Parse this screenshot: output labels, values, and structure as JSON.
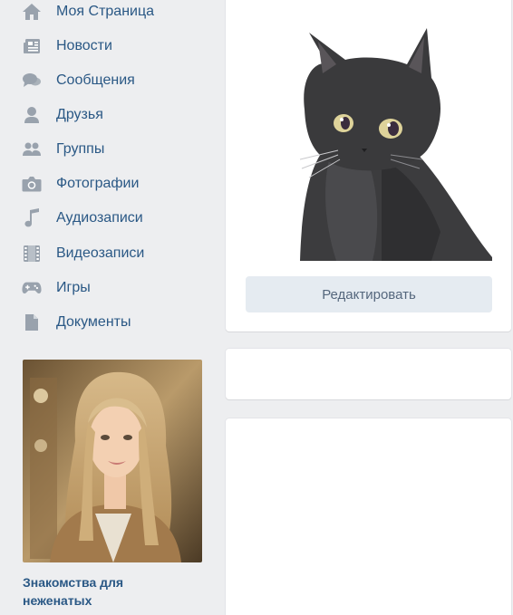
{
  "sidebar": {
    "items": [
      {
        "label": "Моя Страница",
        "icon": "home-icon"
      },
      {
        "label": "Новости",
        "icon": "news-icon"
      },
      {
        "label": "Сообщения",
        "icon": "messages-icon"
      },
      {
        "label": "Друзья",
        "icon": "friends-icon"
      },
      {
        "label": "Группы",
        "icon": "groups-icon"
      },
      {
        "label": "Фотографии",
        "icon": "camera-icon"
      },
      {
        "label": "Аудиозаписи",
        "icon": "music-note-icon"
      },
      {
        "label": "Видеозаписи",
        "icon": "film-icon"
      },
      {
        "label": "Игры",
        "icon": "gamepad-icon"
      },
      {
        "label": "Документы",
        "icon": "document-icon"
      }
    ]
  },
  "ad": {
    "title": "Знакомства для неженатых"
  },
  "profile": {
    "edit_label": "Редактировать"
  },
  "colors": {
    "background": "#edeef0",
    "link": "#2a5885",
    "icon": "#99a2ad",
    "button_bg": "#e5ebf1",
    "button_text": "#55677d"
  }
}
